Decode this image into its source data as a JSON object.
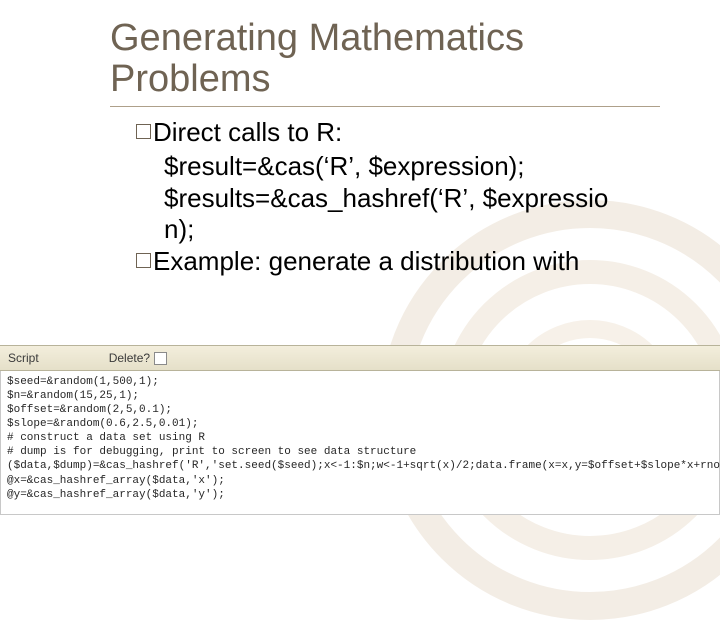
{
  "title": "Generating Mathematics Problems",
  "bullets": {
    "b1_lead": "Direct",
    "b1_rest": " calls to R:",
    "b1_sub1": "$result=&cas(‘R’, $expression);",
    "b1_sub2": "$results=&cas_hashref(‘R’, $expressio",
    "b1_sub3": "n);",
    "b2_lead": "Example:",
    "b2_rest": " generate a distribution with"
  },
  "panel": {
    "script_label": "Script",
    "delete_label": "Delete?",
    "code": "$seed=&random(1,500,1);\n$n=&random(15,25,1);\n$offset=&random(2,5,0.1);\n$slope=&random(0.6,2.5,0.01);\n# construct a data set using R\n# dump is for debugging, print to screen to see data structure\n($data,$dump)=&cas_hashref('R','set.seed($seed);x<-1:$n;w<-1+sqrt(x)/2;data.frame(x=x,y=$offset+$slope*x+rnorm(x)*w);');\n@x=&cas_hashref_array($data,'x');\n@y=&cas_hashref_array($data,'y');"
  }
}
